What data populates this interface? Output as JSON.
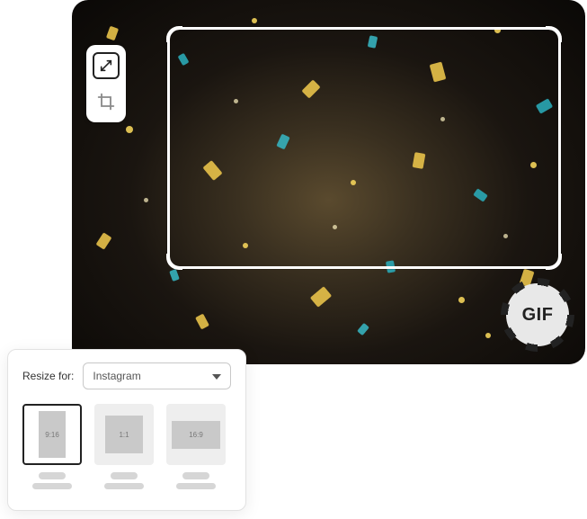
{
  "canvas": {
    "badge_label": "GIF",
    "tools": {
      "resize_icon": "resize-icon",
      "crop_icon": "crop-icon"
    }
  },
  "panel": {
    "label": "Resize for:",
    "select_value": "Instagram",
    "ratios": [
      {
        "label": "9:16",
        "selected": true
      },
      {
        "label": "1:1",
        "selected": false
      },
      {
        "label": "16:9",
        "selected": false
      }
    ]
  }
}
